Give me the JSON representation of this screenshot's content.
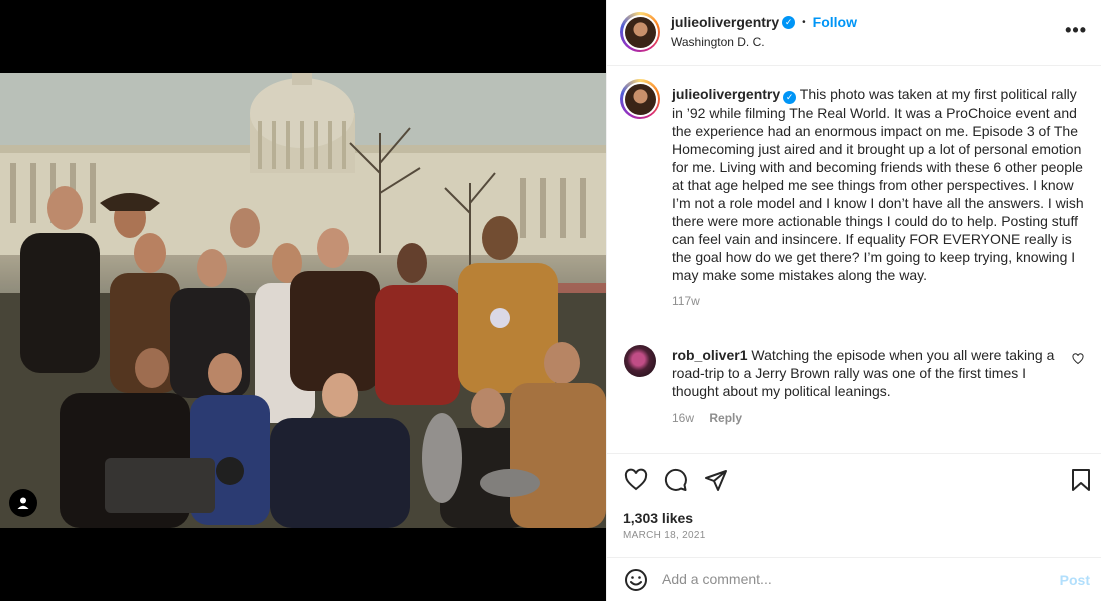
{
  "post": {
    "username": "julieolivergentry",
    "verified": true,
    "follow_label": "Follow",
    "separator": "•",
    "location": "Washington D. C.",
    "more_label": "•••",
    "caption": "This photo was taken at my first political rally in ’92 while filming The Real World. It was a ProChoice event and the experience had an enormous impact on me. Episode 3 of The Homecoming just aired and it brought up a lot of personal emotion for me. Living with and becoming friends with these 6 other people at that age helped me see things from other perspectives. I know I’m not a role model and I know I don’t have all the answers. I wish there were more actionable things I could do to help. Posting stuff can feel vain and insincere. If equality FOR EVERYONE really is the goal how do we get there? I’m going to keep trying, knowing I may make some mistakes along the way.",
    "caption_age": "117w",
    "likes": "1,303 likes",
    "date": "MARCH 18, 2021"
  },
  "comments": [
    {
      "username": "rob_oliver1",
      "text": "Watching the episode when you all were taking a road-trip to a Jerry Brown rally was one of the first times I thought about my political leanings.",
      "age": "16w",
      "reply_label": "Reply"
    }
  ],
  "composer": {
    "placeholder": "Add a comment...",
    "post_label": "Post"
  },
  "icons": {
    "heart": "heart-icon",
    "comment": "comment-icon",
    "share": "share-icon",
    "save": "bookmark-icon",
    "emoji": "emoji-icon",
    "user_tag": "user-tag-icon",
    "verified": "verified-badge-icon",
    "more": "more-options-icon"
  },
  "colors": {
    "accent": "#0095f6",
    "muted": "#8e8e8e",
    "post_disabled": "#b2dffc",
    "text": "#262626",
    "border": "#efefef"
  }
}
